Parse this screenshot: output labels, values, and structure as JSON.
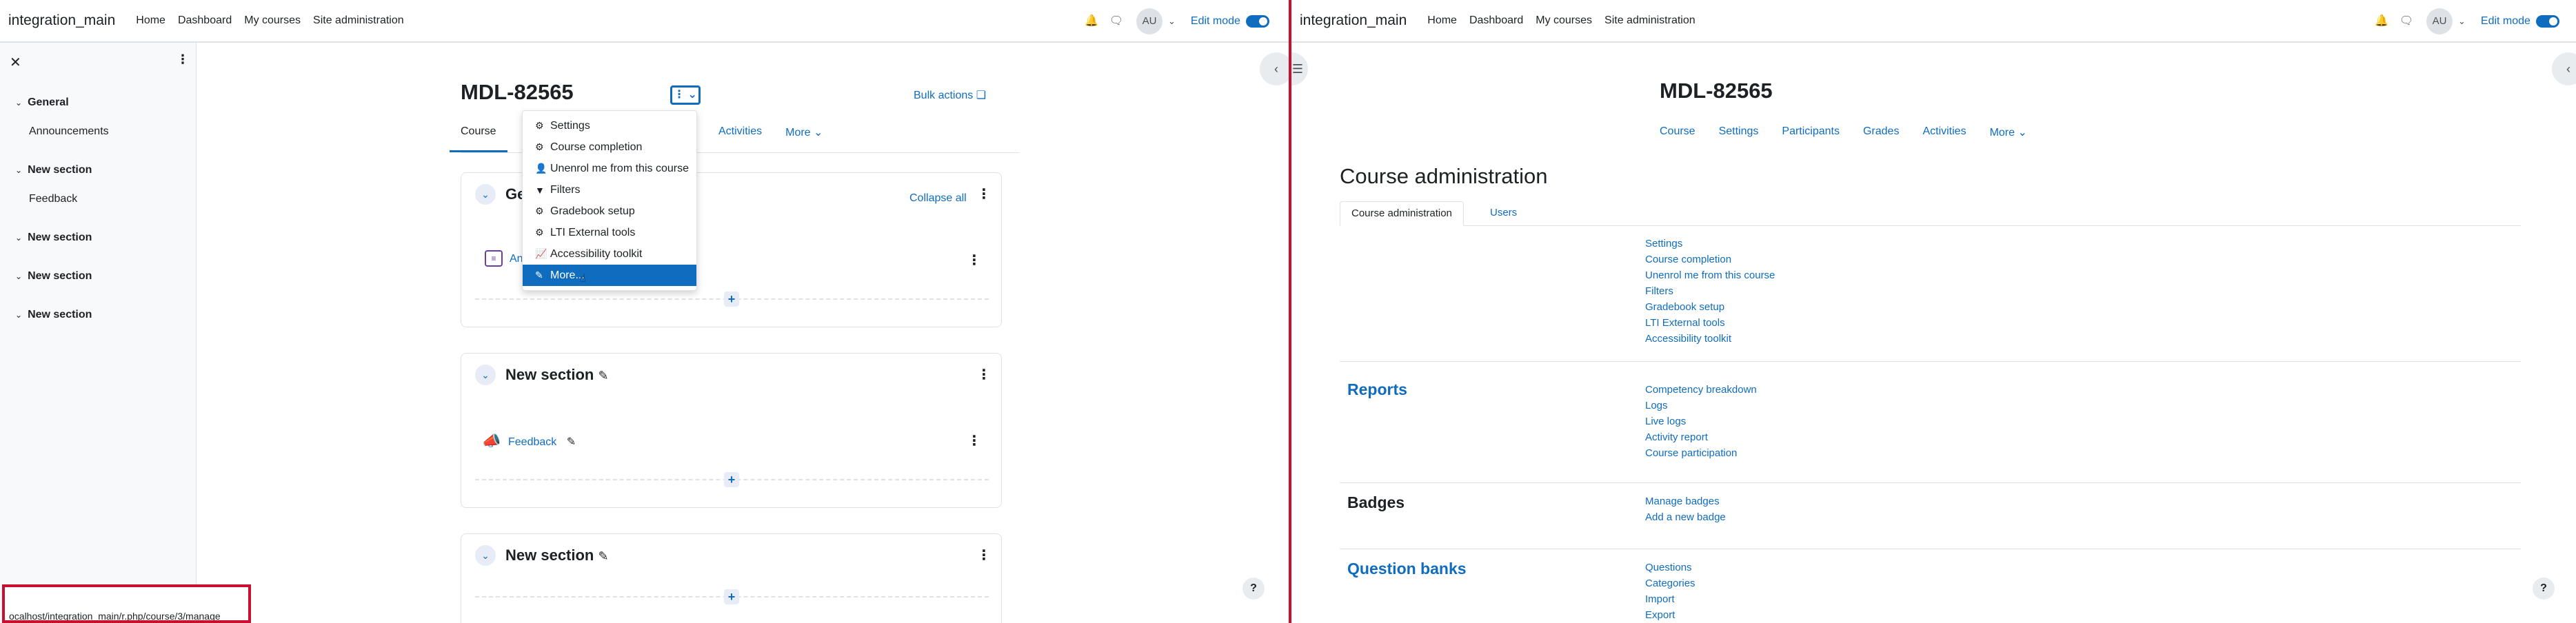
{
  "left": {
    "brand": "integration_main",
    "nav": [
      "Home",
      "Dashboard",
      "My courses",
      "Site administration"
    ],
    "avatar": "AU",
    "edit_mode": "Edit mode",
    "drawer": {
      "sections": [
        {
          "name": "General",
          "activity": "Announcements"
        },
        {
          "name": "New section",
          "activity": "Feedback"
        },
        {
          "name": "New section",
          "activity": ""
        },
        {
          "name": "New section",
          "activity": ""
        },
        {
          "name": "New section",
          "activity": ""
        }
      ]
    },
    "course_title": "MDL-82565",
    "bulk_actions": "Bulk actions",
    "tabs": [
      "Course",
      "Activities",
      "More"
    ],
    "menu": [
      "Settings",
      "Course completion",
      "Unenrol me from this course",
      "Filters",
      "Gradebook setup",
      "LTI External tools",
      "Accessibility toolkit",
      "More..."
    ],
    "general_card": {
      "title_partial": "Ge",
      "collapse_all": "Collapse all",
      "activity_partial": "Ann"
    },
    "sections": [
      {
        "title": "New section",
        "activity": "Feedback"
      },
      {
        "title": "New section"
      }
    ],
    "status_url": "ocalhost/integration_main/r.php/course/3/manage"
  },
  "right": {
    "brand": "integration_main",
    "nav": [
      "Home",
      "Dashboard",
      "My courses",
      "Site administration"
    ],
    "avatar": "AU",
    "edit_mode": "Edit mode",
    "course_title": "MDL-82565",
    "tabs": [
      "Course",
      "Settings",
      "Participants",
      "Grades",
      "Activities",
      "More"
    ],
    "page_title": "Course administration",
    "subtabs": [
      "Course administration",
      "Users"
    ],
    "admin_links": [
      "Settings",
      "Course completion",
      "Unenrol me from this course",
      "Filters",
      "Gradebook setup",
      "LTI External tools",
      "Accessibility toolkit"
    ],
    "categories": [
      {
        "name": "Reports",
        "links": [
          "Competency breakdown",
          "Logs",
          "Live logs",
          "Activity report",
          "Course participation"
        ]
      },
      {
        "name": "Badges",
        "links": [
          "Manage badges",
          "Add a new badge"
        ]
      },
      {
        "name": "Question banks",
        "links": [
          "Questions",
          "Categories",
          "Import",
          "Export"
        ]
      }
    ]
  },
  "colors": {
    "accent": "#0f6cbf",
    "divider": "#c8102e",
    "highlight": "#0f6cbf"
  }
}
